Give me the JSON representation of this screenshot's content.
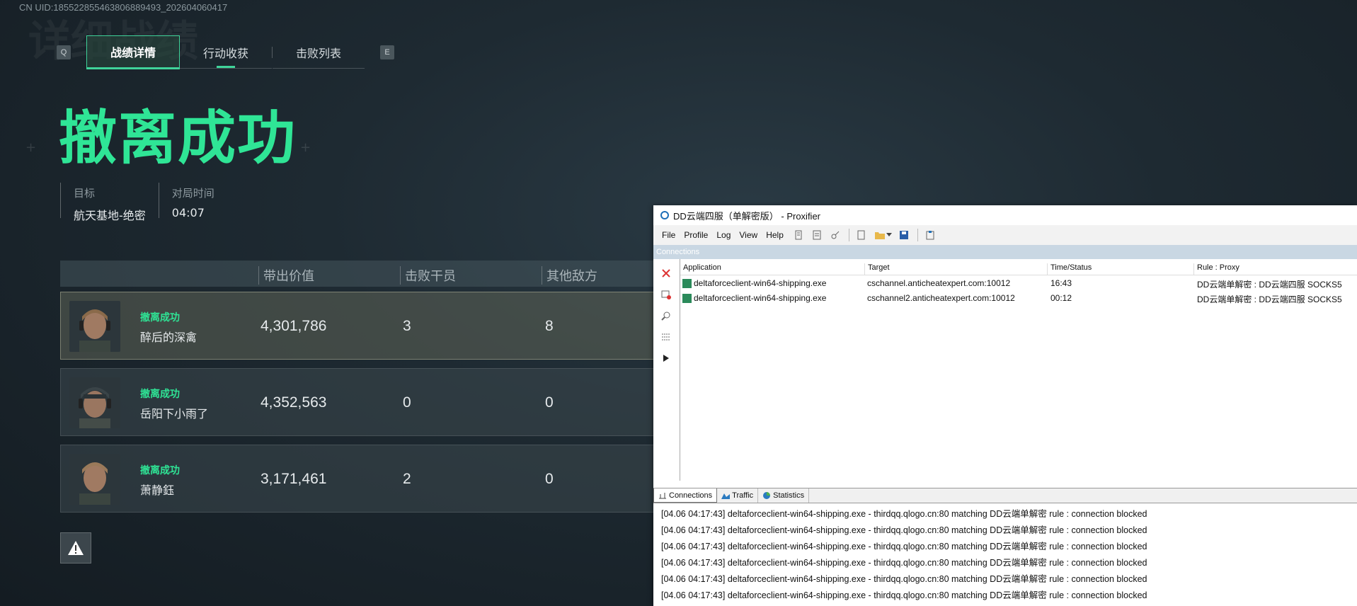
{
  "uid": "CN UID:1855228554638068894​93_202604060417",
  "bg_ghost_text": "详细战绩",
  "tabs": {
    "key_left": "Q",
    "key_right": "E",
    "items": [
      {
        "label": "战绩详情"
      },
      {
        "label": "行动收获"
      },
      {
        "label": "击败列表"
      }
    ]
  },
  "result_title": "撤离成功",
  "info": {
    "target_label": "目标",
    "target_value": "航天基地-绝密",
    "time_label": "对局时间",
    "time_value": "04:07"
  },
  "table": {
    "columns": [
      "带出价值",
      "击败干员",
      "其他敌方"
    ],
    "rows": [
      {
        "status": "撤离成功",
        "name": "醉后的深禽",
        "value": "4,301,786",
        "kills": "3",
        "others": "8"
      },
      {
        "status": "撤离成功",
        "name": "岳阳下小雨了",
        "value": "4,352,563",
        "kills": "0",
        "others": "0"
      },
      {
        "status": "撤离成功",
        "name": "萧静鈺",
        "value": "3,171,461",
        "kills": "2",
        "others": "0"
      }
    ]
  },
  "proxifier": {
    "title": "DD云端四服（单解密版） - Proxifier",
    "menus": [
      "File",
      "Profile",
      "Log",
      "View",
      "Help"
    ],
    "panel_header": "Connections",
    "columns": [
      "Application",
      "Target",
      "Time/Status",
      "Rule : Proxy"
    ],
    "connections": [
      {
        "app": "deltaforceclient-win64-shipping.exe",
        "target": "cschannel.anticheatexpert.com:10012",
        "time": "16:43",
        "rule": "DD云端单解密 : DD云端四服 SOCKS5"
      },
      {
        "app": "deltaforceclient-win64-shipping.exe",
        "target": "cschannel2.anticheatexpert.com:10012",
        "time": "00:12",
        "rule": "DD云端单解密 : DD云端四服 SOCKS5"
      }
    ],
    "bottom_tabs": [
      "Connections",
      "Traffic",
      "Statistics"
    ],
    "log": [
      "[04.06 04:17:43] deltaforceclient-win64-shipping.exe - thirdqq.qlogo.cn:80 matching DD云端单解密 rule : connection blocked",
      "[04.06 04:17:43] deltaforceclient-win64-shipping.exe - thirdqq.qlogo.cn:80 matching DD云端单解密 rule : connection blocked",
      "[04.06 04:17:43] deltaforceclient-win64-shipping.exe - thirdqq.qlogo.cn:80 matching DD云端单解密 rule : connection blocked",
      "[04.06 04:17:43] deltaforceclient-win64-shipping.exe - thirdqq.qlogo.cn:80 matching DD云端单解密 rule : connection blocked",
      "[04.06 04:17:43] deltaforceclient-win64-shipping.exe - thirdqq.qlogo.cn:80 matching DD云端单解密 rule : connection blocked",
      "[04.06 04:17:43] deltaforceclient-win64-shipping.exe - thirdqq.qlogo.cn:80 matching DD云端单解密 rule : connection blocked"
    ]
  },
  "colors": {
    "accent_green": "#2fe596",
    "tab_active_border": "#3fd39a"
  }
}
